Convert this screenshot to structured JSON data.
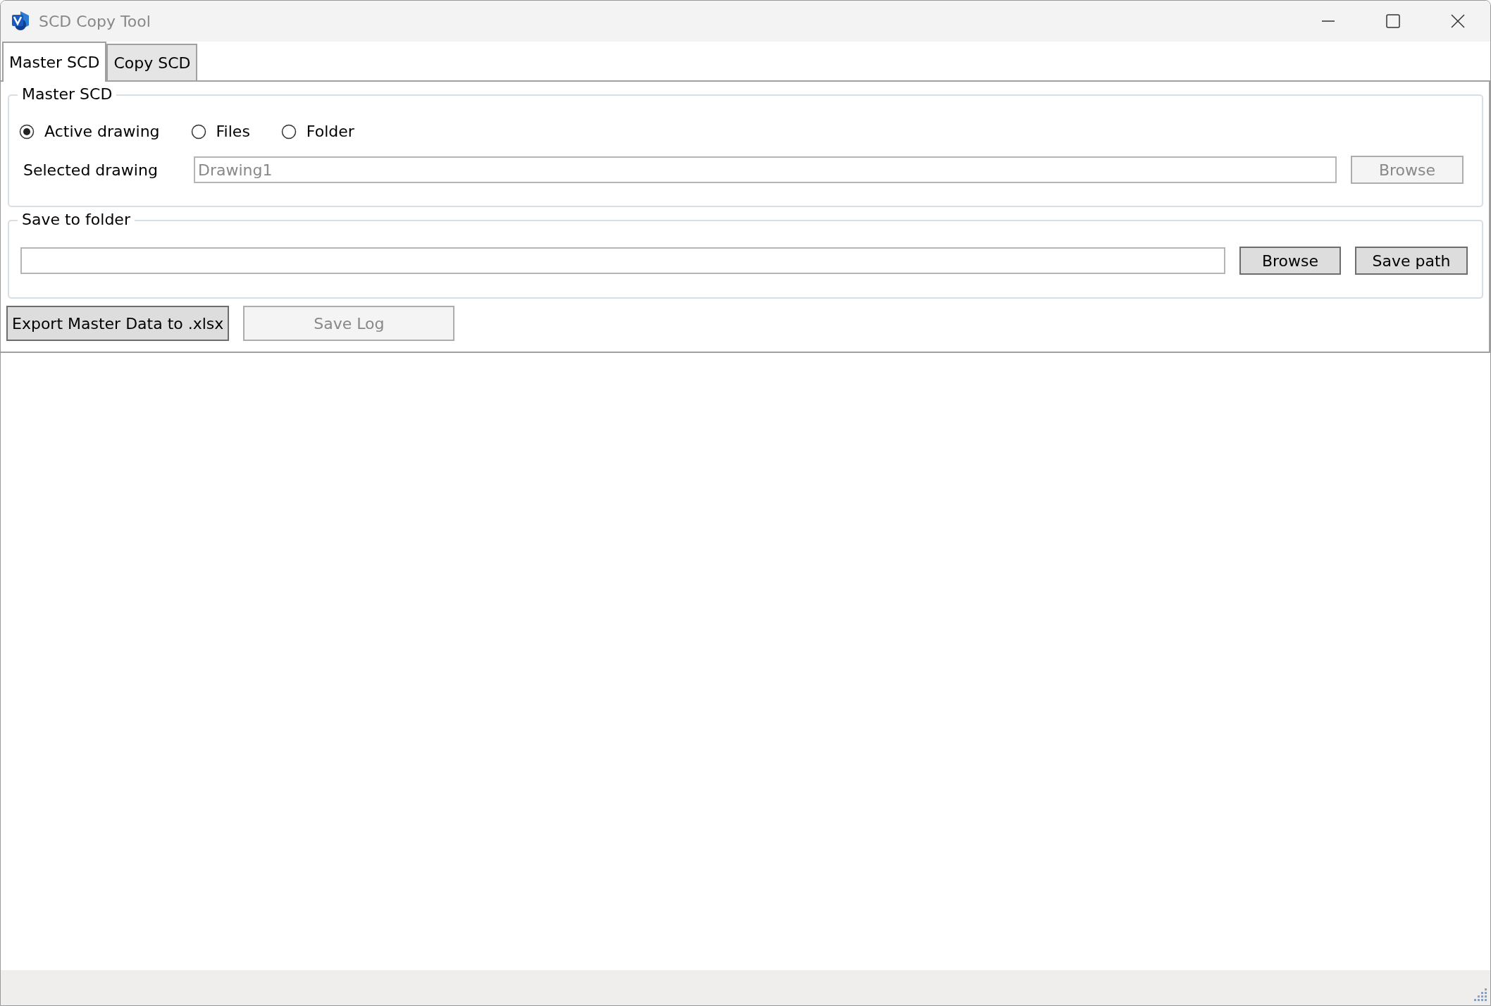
{
  "window": {
    "title": "SCD Copy Tool"
  },
  "tabs": [
    {
      "label": "Master SCD",
      "selected": true
    },
    {
      "label": "Copy SCD",
      "selected": false
    }
  ],
  "master_scd": {
    "legend": "Master SCD",
    "source_options": [
      {
        "label": "Active drawing",
        "selected": true
      },
      {
        "label": "Files",
        "selected": false
      },
      {
        "label": "Folder",
        "selected": false
      }
    ],
    "selected_drawing": {
      "label": "Selected drawing",
      "value": "Drawing1",
      "disabled": true
    },
    "browse_button": {
      "label": "Browse",
      "disabled": true
    }
  },
  "save_to_folder": {
    "legend": "Save to folder",
    "buttons": [
      {
        "label": "Browse",
        "disabled": false
      },
      {
        "label": "Save path",
        "disabled": false
      }
    ]
  },
  "actions": [
    {
      "label": "Export Master Data to .xlsx",
      "disabled": false
    },
    {
      "label": "Save Log",
      "disabled": true
    }
  ]
}
